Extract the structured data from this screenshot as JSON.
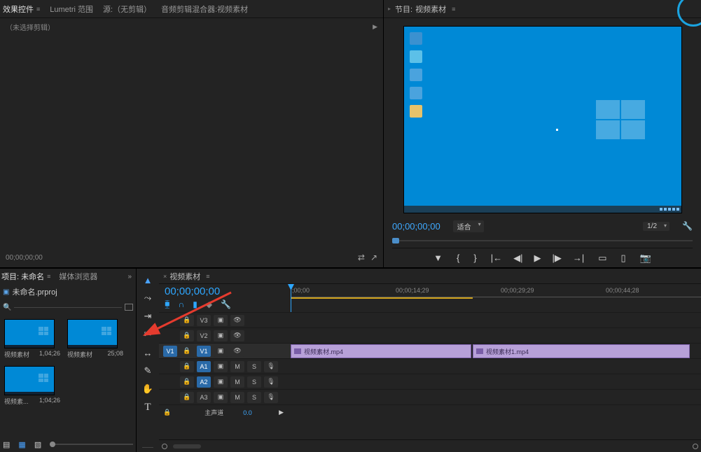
{
  "source_panel": {
    "tabs": [
      "效果控件",
      "Lumetri 范围",
      "源:（无剪辑）",
      "音频剪辑混合器:视频素材"
    ],
    "active_tab_index": 0,
    "subtitle": "（未选择剪辑）",
    "footer_tc": "00;00;00;00"
  },
  "program_panel": {
    "title_prefix": "节目:",
    "title": "视频素材",
    "timecode": "00;00;00;00",
    "fit_label": "适合",
    "zoom_label": "1/2"
  },
  "project_panel": {
    "tabs": [
      "项目: 未命名",
      "媒体浏览器"
    ],
    "active_tab_index": 0,
    "filename": "未命名.prproj",
    "clips": [
      {
        "name": "视频素材",
        "dur": "1,04;26"
      },
      {
        "name": "视频素材",
        "dur": "25;08"
      },
      {
        "name": "视频素...",
        "dur": "1;04;26"
      }
    ]
  },
  "tools": [
    "selection",
    "track-select",
    "ripple",
    "razor",
    "slip",
    "pen",
    "hand",
    "type"
  ],
  "timeline": {
    "sequence_name": "视频素材",
    "timecode": "00;00;00;00",
    "ruler_marks": [
      ";00;00",
      "00;00;14;29",
      "00;00;29;29",
      "00;00;44;28"
    ],
    "video_tracks": [
      "V3",
      "V2",
      "V1"
    ],
    "audio_tracks": [
      "A1",
      "A2",
      "A3"
    ],
    "source_target": "V1",
    "master_label": "主声道",
    "master_value": "0.0",
    "clips": [
      {
        "name": "视频素材.mp4"
      },
      {
        "name": "视频素材1.mp4"
      }
    ]
  },
  "glyphs": {
    "burger": "≡",
    "play_r": "▶",
    "lock": "🔒",
    "eye": "👁",
    "mute": "M",
    "solo": "S",
    "mic": "🎤",
    "mark_in": "{",
    "mark_out": "}",
    "go_in": "|←",
    "step_back": "◀|",
    "play": "▶",
    "step_fwd": "|▶",
    "go_out": "→|",
    "lift": "▭",
    "extract": "▯",
    "export": "▢",
    "camera": "📷",
    "wrench": "🔧",
    "shield": "◆",
    "snap": "⧉",
    "link": "∩",
    "marker": "▼"
  }
}
